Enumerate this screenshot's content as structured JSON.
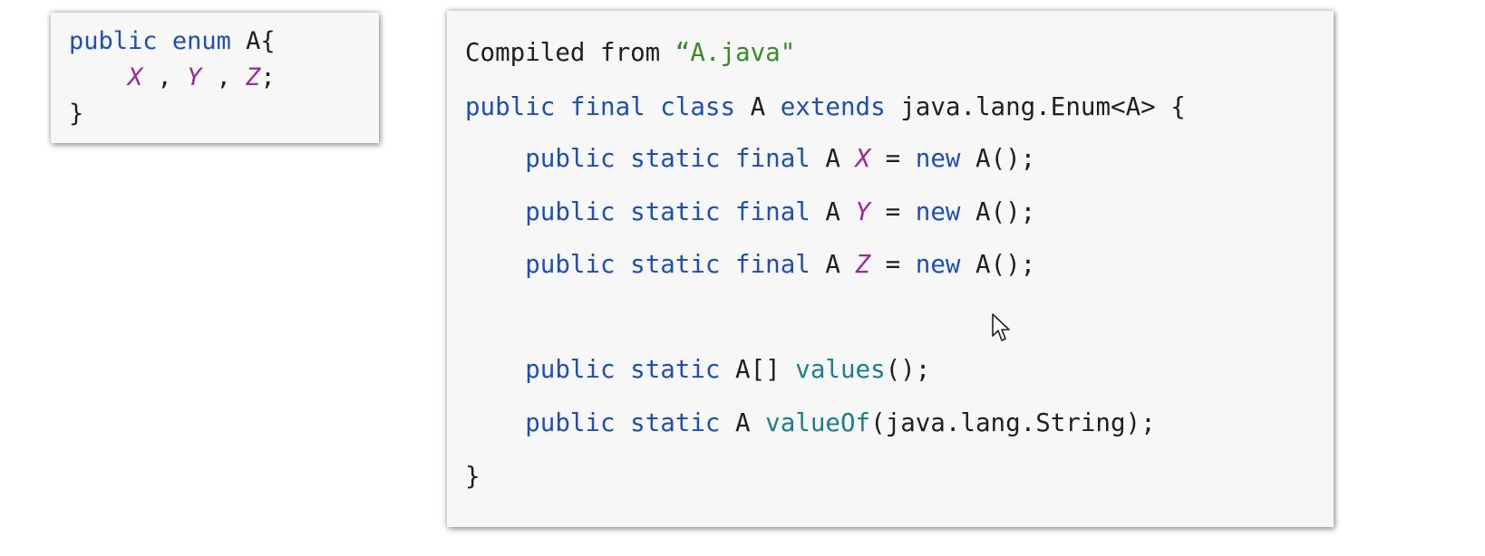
{
  "enum_snippet": {
    "lines": [
      {
        "t1": "public",
        "t2": "enum",
        "t3": "A{"
      },
      {
        "c1": "X",
        "sep1": " , ",
        "c2": "Y",
        "sep2": " , ",
        "c3": "Z",
        "end": ";"
      },
      {
        "brace": "}"
      }
    ]
  },
  "decompiled": {
    "header_prefix": "Compiled from ",
    "header_file": "“A.java\"",
    "class_decl": {
      "kw1": "public",
      "kw2": "final",
      "kw3": "class",
      "name": "A",
      "kw4": "extends",
      "rest": "java.lang.Enum<A> {"
    },
    "fields": [
      {
        "kw1": "public",
        "kw2": "static",
        "kw3": "final",
        "type": "A",
        "name": "X",
        "eq": "=",
        "kw4": "new",
        "ctor": "A();"
      },
      {
        "kw1": "public",
        "kw2": "static",
        "kw3": "final",
        "type": "A",
        "name": "Y",
        "eq": "=",
        "kw4": "new",
        "ctor": "A();"
      },
      {
        "kw1": "public",
        "kw2": "static",
        "kw3": "final",
        "type": "A",
        "name": "Z",
        "eq": "=",
        "kw4": "new",
        "ctor": "A();"
      }
    ],
    "methods": [
      {
        "kw1": "public",
        "kw2": "static",
        "type": "A[]",
        "fn": "values",
        "args": "();"
      },
      {
        "kw1": "public",
        "kw2": "static",
        "type": "A",
        "fn": "valueOf",
        "args": "(java.lang.String);"
      }
    ],
    "closing": "}"
  },
  "colors": {
    "keyword": "#1f4fb0",
    "constant": "#9a2b9c",
    "method": "#1a7f8e",
    "string": "#3a8a2c"
  },
  "icons": {
    "cursor": "mouse-pointer-icon"
  }
}
